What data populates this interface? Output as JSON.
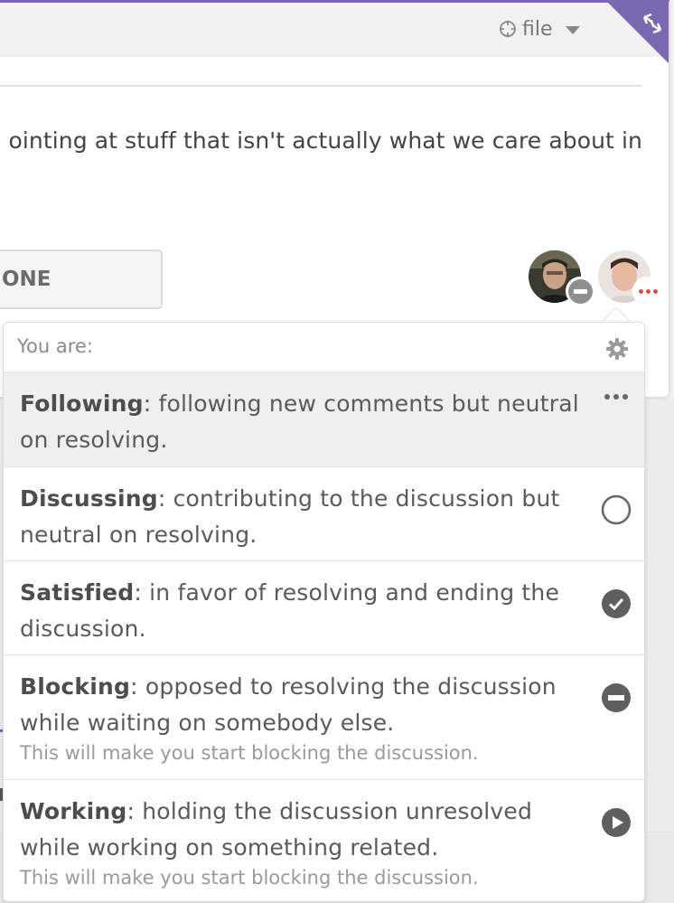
{
  "header": {
    "file_label": "file",
    "file_icon": "crosshair-icon",
    "caret_icon": "caret-down-icon",
    "corner_icon": "swap-arrows-icon"
  },
  "comment": {
    "text": "ointing at stuff that isn't actually what we care about in"
  },
  "done_button": {
    "label": "ONE"
  },
  "participants": [
    {
      "name": "avatar-participant-1",
      "status": "blocking"
    },
    {
      "name": "avatar-participant-2",
      "status": "following"
    }
  ],
  "status_menu": {
    "title": "You are:",
    "settings_icon": "gear-icon",
    "options": [
      {
        "name": "Following",
        "description": ": following new comments but neutral on resolving.",
        "note": "",
        "icon": "more-dots-icon",
        "active": true
      },
      {
        "name": "Discussing",
        "description": ": contributing to the discussion but neutral on resolving.",
        "note": "",
        "icon": "empty-circle-icon",
        "active": false
      },
      {
        "name": "Satisfied",
        "description": ": in favor of resolving and ending the discussion.",
        "note": "",
        "icon": "check-circle-icon",
        "active": false
      },
      {
        "name": "Blocking",
        "description": ": opposed to resolving the discussion while waiting on somebody else.",
        "note": "This will make you start blocking the discussion.",
        "icon": "minus-circle-icon",
        "active": false
      },
      {
        "name": "Working",
        "description": ": holding the discussion unresolved while working on something related.",
        "note": "This will make you start blocking the discussion.",
        "icon": "play-circle-icon",
        "active": false
      }
    ]
  },
  "colors": {
    "accent": "#7a68b0",
    "icon_dark": "#5f5f5f",
    "following_dots": "#e05050"
  }
}
